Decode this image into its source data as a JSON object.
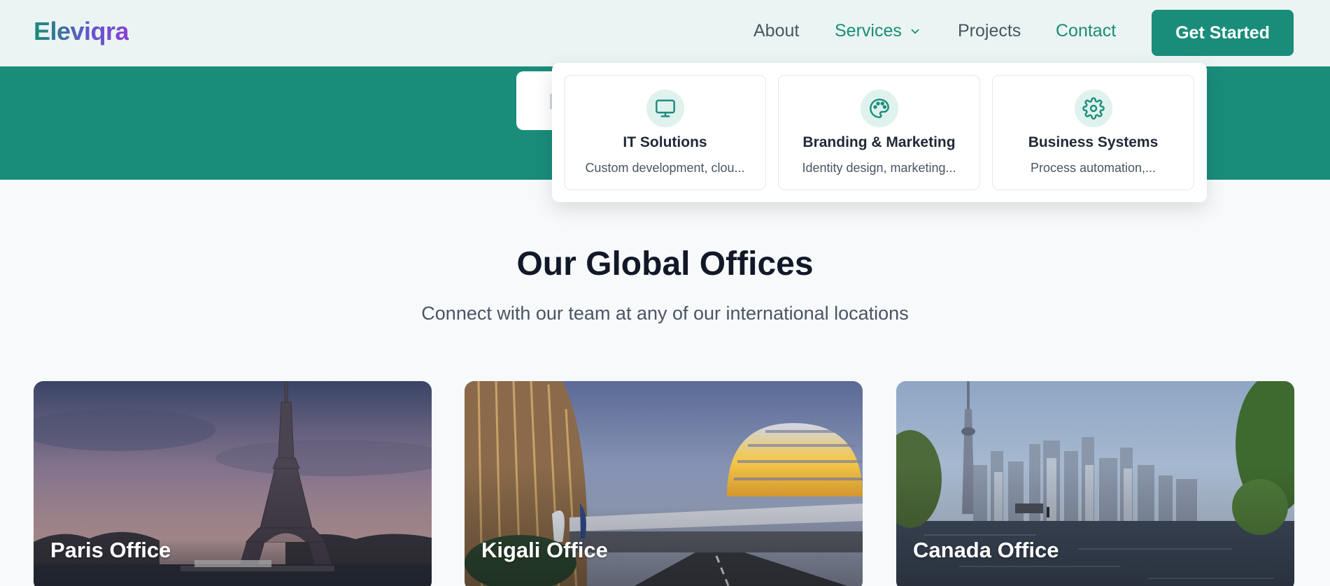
{
  "header": {
    "logo": "Eleviqra",
    "nav": {
      "about": "About",
      "services": "Services",
      "projects": "Projects",
      "contact": "Contact"
    },
    "cta_label": "Get Started"
  },
  "services_dropdown": {
    "items": [
      {
        "title": "IT Solutions",
        "description": "Custom development, clou...",
        "icon": "monitor-icon"
      },
      {
        "title": "Branding & Marketing",
        "description": "Identity design, marketing...",
        "icon": "palette-icon"
      },
      {
        "title": "Business Systems",
        "description": "Process automation,...",
        "icon": "gear-icon"
      }
    ]
  },
  "offices_section": {
    "title": "Our Global Offices",
    "subtitle": "Connect with our team at any of our international locations",
    "offices": [
      {
        "label": "Paris Office"
      },
      {
        "label": "Kigali Office"
      },
      {
        "label": "Canada Office"
      }
    ]
  },
  "colors": {
    "accent": "#1a8c7a",
    "logo_gradient_end": "#8b3fd6",
    "header_bg": "#eaf4f2",
    "page_bg": "#f7f9fb"
  }
}
